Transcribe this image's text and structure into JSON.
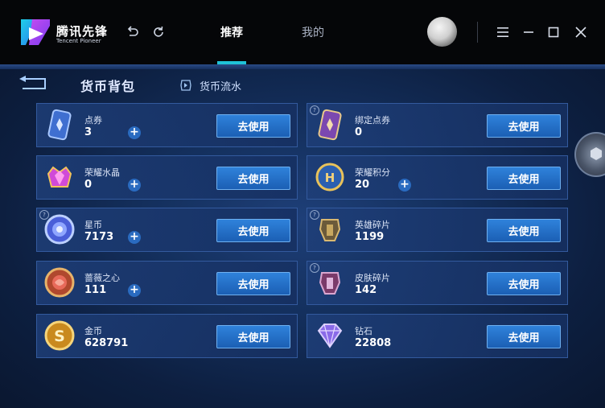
{
  "app": {
    "logo_cn": "腾讯先锋",
    "logo_en": "Tencent Pioneer",
    "brand_color": "#1fc2d8"
  },
  "toolbar": {
    "undo_icon": "undo-icon",
    "refresh_icon": "refresh-icon"
  },
  "tabs": [
    {
      "label": "推荐",
      "active": true
    },
    {
      "label": "我的",
      "active": false
    }
  ],
  "window_controls": [
    "menu-icon",
    "minimize-icon",
    "maximize-icon",
    "close-icon"
  ],
  "page": {
    "title": "货币背包",
    "flow_label": "货币流水"
  },
  "currencies": [
    {
      "name": "点券",
      "value": "3",
      "plus": true,
      "help": false,
      "button": "去使用"
    },
    {
      "name": "绑定点券",
      "value": "0",
      "plus": false,
      "help": true,
      "button": "去使用"
    },
    {
      "name": "荣耀水晶",
      "value": "0",
      "plus": true,
      "help": false,
      "button": "去使用"
    },
    {
      "name": "荣耀积分",
      "value": "20",
      "plus": true,
      "help": false,
      "button": "去使用"
    },
    {
      "name": "星币",
      "value": "7173",
      "plus": true,
      "help": true,
      "button": "去使用"
    },
    {
      "name": "英雄碎片",
      "value": "1199",
      "plus": false,
      "help": true,
      "button": "去使用"
    },
    {
      "name": "蔷薇之心",
      "value": "111",
      "plus": true,
      "help": false,
      "button": "去使用"
    },
    {
      "name": "皮肤碎片",
      "value": "142",
      "plus": false,
      "help": true,
      "button": "去使用"
    },
    {
      "name": "金币",
      "value": "628791",
      "plus": false,
      "help": false,
      "button": "去使用"
    },
    {
      "name": "钻石",
      "value": "22808",
      "plus": false,
      "help": false,
      "button": "去使用"
    }
  ]
}
